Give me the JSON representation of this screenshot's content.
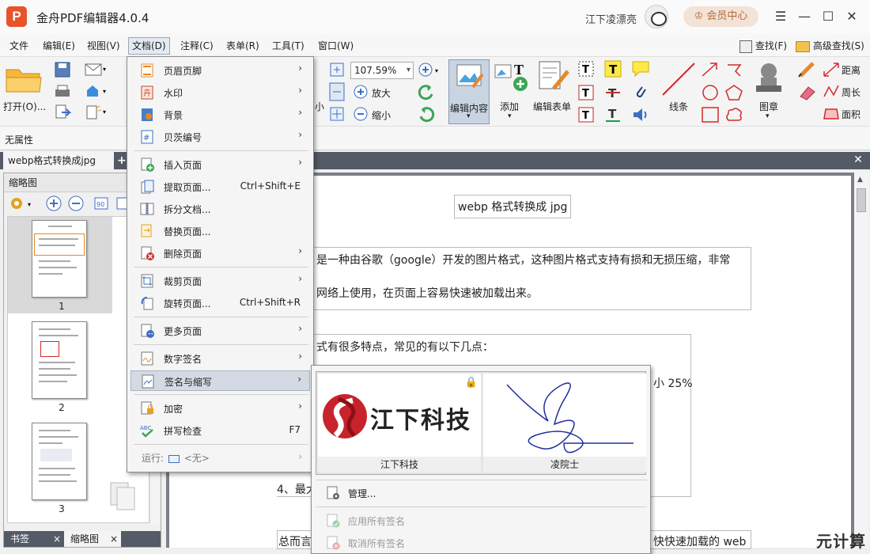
{
  "titlebar": {
    "logo": "P",
    "title": "金舟PDF编辑器4.0.4",
    "user_name": "江下凌漂亮",
    "member_center": "会员中心"
  },
  "menubar": {
    "items": [
      "文件",
      "编辑(E)",
      "视图(V)",
      "文档(D)",
      "注释(C)",
      "表单(R)",
      "工具(T)",
      "窗口(W)"
    ],
    "search": "查找(F)",
    "advanced_search": "高级查找(S)"
  },
  "toolbar": {
    "open": "打开(O)...",
    "small": "小",
    "zoom": "107.59%",
    "zoom_in": "放大",
    "zoom_out": "缩小",
    "edit_content": "编辑内容",
    "add": "添加",
    "edit_form": "编辑表单",
    "line": "线条",
    "stamp": "图章",
    "distance": "距离",
    "perimeter": "周长",
    "area": "面积"
  },
  "propbar": {
    "label": "无属性"
  },
  "tabs": {
    "document": "webp格式转换成jpg"
  },
  "leftpanel": {
    "title": "缩略图",
    "pages": [
      "1",
      "2",
      "3"
    ],
    "bottom_tabs": [
      "书签",
      "缩略图"
    ]
  },
  "document": {
    "title": "webp 格式转换成 jpg",
    "para1_line1": "是一种由谷歌（google）开发的图片格式，这种图片格式支持有损和无损压缩，非常",
    "para1_line2": "网络上使用，在页面上容易快速被加载出来。",
    "para2": "式有很多特点，常见的有以下几点：",
    "fragment_25": "小 25%",
    "item4": "4、最大",
    "last_left": "总而言",
    "last_right": "快快速加载的 web"
  },
  "doc_menu": {
    "items": [
      {
        "label": "页眉页脚",
        "submenu": true
      },
      {
        "label": "水印",
        "submenu": true
      },
      {
        "label": "背景",
        "submenu": true
      },
      {
        "label": "贝茨编号",
        "submenu": true
      },
      {
        "label": "插入页面",
        "submenu": true
      },
      {
        "label": "提取页面...",
        "shortcut": "Ctrl+Shift+E"
      },
      {
        "label": "拆分文档..."
      },
      {
        "label": "替换页面..."
      },
      {
        "label": "删除页面",
        "submenu": true
      },
      {
        "label": "裁剪页面",
        "submenu": true
      },
      {
        "label": "旋转页面...",
        "shortcut": "Ctrl+Shift+R"
      },
      {
        "label": "更多页面",
        "submenu": true
      },
      {
        "label": "数字签名",
        "submenu": true
      },
      {
        "label": "签名与缩写",
        "submenu": true
      },
      {
        "label": "加密",
        "submenu": true
      },
      {
        "label": "拼写检查",
        "shortcut": "F7"
      }
    ],
    "run_label": "运行:",
    "run_value": "<无>"
  },
  "signature_menu": {
    "cards": [
      {
        "name": "江下科技",
        "logo_text": "江下科技"
      },
      {
        "name": "凌院士"
      }
    ],
    "manage": "管理...",
    "apply_all": "应用所有签名",
    "cancel_all": "取消所有签名"
  },
  "watermark": "元计算"
}
